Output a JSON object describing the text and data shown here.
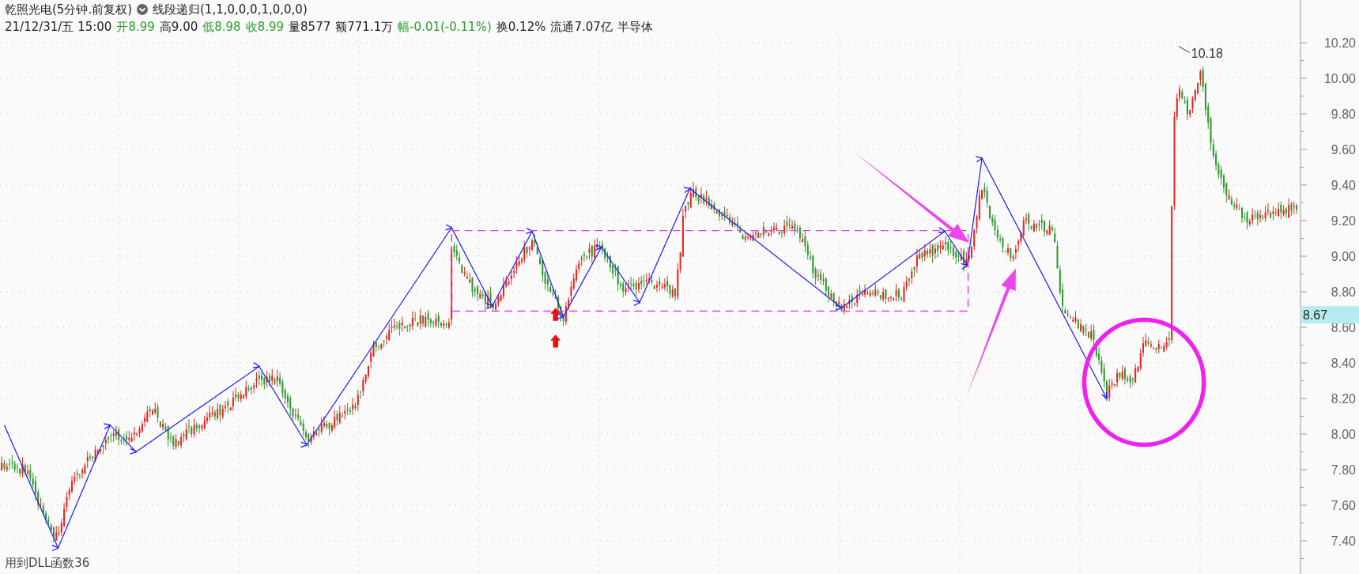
{
  "header": {
    "title": "乾照光电(5分钟.前复权)",
    "indicator": "线段递归(1,1,0,0,0,1,0,0,0)",
    "quote": [
      {
        "text": "21/12/31/五 15:00",
        "color": "#222222"
      },
      {
        "text": "开8.99",
        "color": "#2e9e2e"
      },
      {
        "text": "高9.00",
        "color": "#222222"
      },
      {
        "text": "低8.98",
        "color": "#2e9e2e"
      },
      {
        "text": "收8.99",
        "color": "#2e9e2e"
      },
      {
        "text": "量8577",
        "color": "#222222"
      },
      {
        "text": "额771.1万",
        "color": "#222222"
      },
      {
        "text": "幅-0.01(-0.11%)",
        "color": "#2e9e2e"
      },
      {
        "text": "换0.12%",
        "color": "#222222"
      },
      {
        "text": "流通7.07亿",
        "color": "#222222"
      },
      {
        "text": "半导体",
        "color": "#222222"
      }
    ]
  },
  "chart": {
    "high_label": "10.18",
    "price_tag": "8.67",
    "price_axis": [
      "10.20",
      "10.00",
      "9.80",
      "9.60",
      "9.40",
      "9.20",
      "9.00",
      "8.80",
      "8.60",
      "8.40",
      "8.20",
      "8.00",
      "7.80",
      "7.60",
      "7.40"
    ]
  },
  "footer": "用到DLL函数36"
}
